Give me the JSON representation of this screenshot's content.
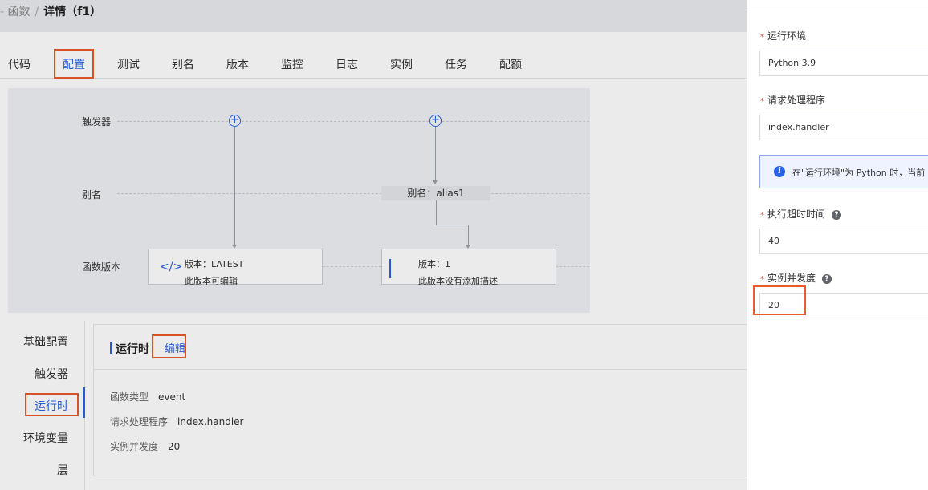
{
  "breadcrumb": {
    "parent": "函数",
    "separator": "/",
    "current": "详情（f1）"
  },
  "tabs": [
    "代码",
    "配置",
    "测试",
    "别名",
    "版本",
    "监控",
    "日志",
    "实例",
    "任务",
    "配额"
  ],
  "active_tab": "配置",
  "topology": {
    "rows": {
      "trigger": "触发器",
      "alias": "别名",
      "version": "函数版本"
    },
    "alias_chip": "别名：alias1",
    "versions": [
      {
        "title": "版本：LATEST",
        "desc": "此版本可编辑",
        "icon": "code-icon"
      },
      {
        "title": "版本：1",
        "desc": "此版本没有添加描述",
        "icon": "bar-icon"
      }
    ]
  },
  "side_menu": {
    "items": [
      "基础配置",
      "触发器",
      "运行时",
      "环境变量",
      "层"
    ],
    "active": "运行时"
  },
  "runtime_panel": {
    "title": "运行时",
    "edit_label": "编辑",
    "fields": [
      {
        "key": "函数类型",
        "value": "event"
      },
      {
        "key": "请求处理程序",
        "value": "index.handler"
      },
      {
        "key": "实例并发度",
        "value": "20"
      }
    ]
  },
  "drawer": {
    "required_mark": "*",
    "runtime_label": "运行环境",
    "runtime_value": "Python 3.9",
    "handler_label": "请求处理程序",
    "handler_value": "index.handler",
    "info_text": "在\"运行环境\"为 Python 时，当前",
    "timeout_label": "执行超时时间",
    "timeout_value": "40",
    "concurrency_label": "实例并发度",
    "concurrency_value": "20",
    "help_glyph": "?",
    "info_glyph": "i"
  },
  "colors": {
    "accent": "#2a62e8",
    "highlight": "#ea5a2b",
    "required": "#e83a2b"
  }
}
